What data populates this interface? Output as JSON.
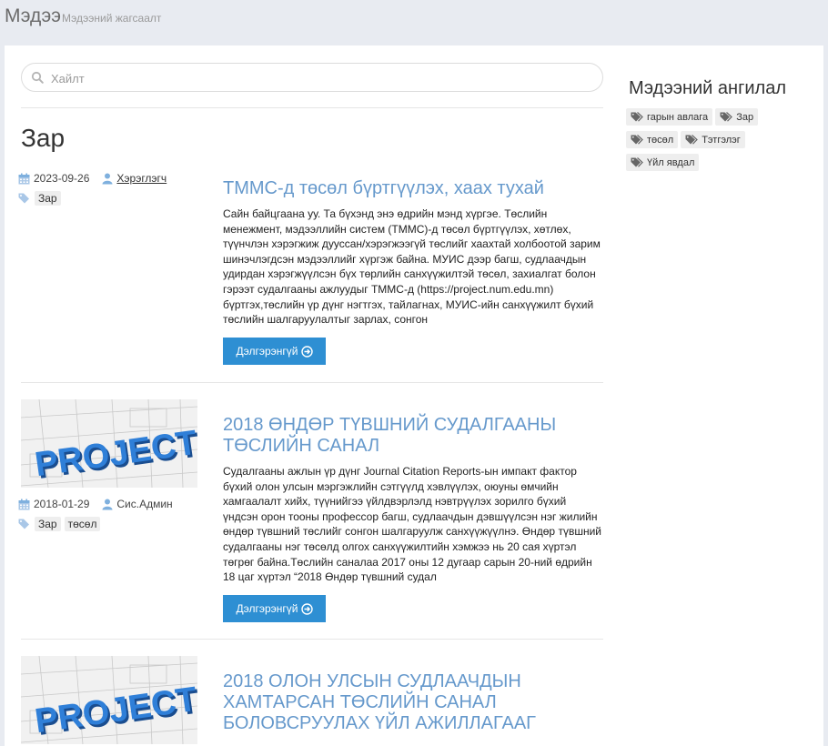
{
  "site": {
    "title": "Мэдээ",
    "subtitle": "Мэдээний жагсаалт"
  },
  "search": {
    "placeholder": "Хайлт"
  },
  "page_title": "Зар",
  "sidebar": {
    "title": "Мэдээний ангилал",
    "tags": [
      "гарын авлага",
      "Зар",
      "төсөл",
      "Тэтгэлэг",
      "Үйл явдал"
    ]
  },
  "read_more_label": "Дэлгэрэнгүй",
  "thumbnail_text": "PROJECT",
  "posts": [
    {
      "date": "2023-09-26",
      "author": "Хэрэглэгч",
      "tags": [
        "Зар"
      ],
      "title": "ТММС-д төсөл бүртгүүлэх, хаах тухай",
      "body": "Сайн байцгаана уу. Та бүхэнд энэ өдрийн мэнд хүргэе. Төслийн менежмент, мэдээллийн систем (ТММС)-д төсөл бүртгүүлэх, хөтлөх, түүнчлэн хэрэгжиж дууссан/хэрэгжээгүй төслийг хаахтай холбоотой зарим шинэчлэгдсэн мэдээллийг хүргэж байна.  МУИС дээр багш, судлаачдын удирдан хэрэгжүүлсэн бүх төрлийн санхүүжилтэй төсөл, захиалгат болон гэрээт судалгааны ажлуудыг ТММС-д (https://project.num.edu.mn) бүртгэх,төслийн үр дүнг нэгтгэх, тайлагнах, МУИС-ийн санхүүжилт бүхий төслийн шалгаруулалтыг зарлах, сонгон"
    },
    {
      "date": "2018-01-29",
      "author": "Сис.Админ",
      "tags": [
        "Зар",
        "төсөл"
      ],
      "title": "2018 ӨНДӨР ТҮВШНИЙ СУДАЛГААНЫ ТӨСЛИЙН САНАЛ",
      "body": "Судалгааны ажлын үр дүнг Journal Citation Reports-ын импакт фактор бүхий олон улсын мэргэжлийн сэтгүүлд хэвлүүлэх, оюуны өмчийн хамгаалалт хийх, түүнийгээ үйлдвэрлэлд нэвтрүүлэх зорилго бүхий үндсэн орон тооны профессор багш, судлаачдын дэвшүүлсэн нэг жилийн өндөр түвшний төслийг сонгон шалгаруулж санхүүжүүлнэ. Өндөр түвшний судалгааны нэг төсөлд олгох санхүүжилтийн хэмжээ нь 20 сая хүртэл төгрөг байна.Төслийн саналаа 2017 оны 12 дугаар сарын 20-ний өдрийн 18 цаг хүртэл “2018 Өндөр түвшний судал"
    },
    {
      "title": "2018 ОЛОН УЛСЫН СУДЛААЧДЫН ХАМТАРСАН ТӨСЛИЙН САНАЛ БОЛОВСРУУЛАХ ҮЙЛ АЖИЛЛАГААГ"
    }
  ]
}
